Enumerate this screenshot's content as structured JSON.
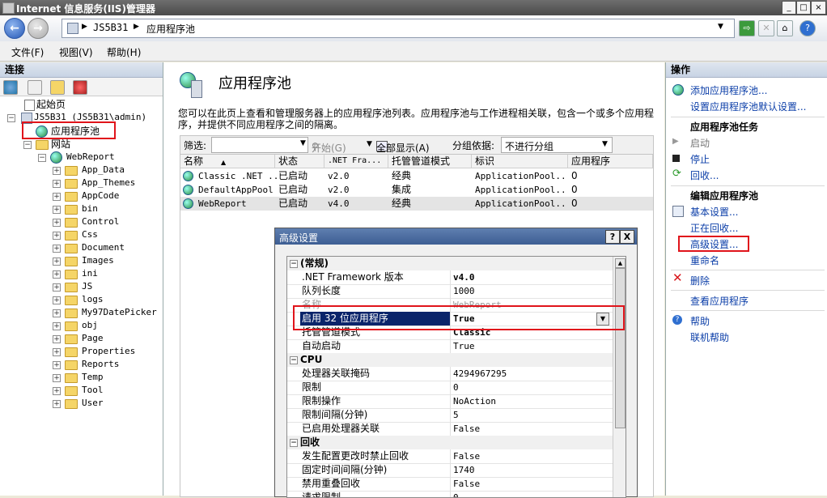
{
  "window": {
    "title": "Internet 信息服务(IIS)管理器"
  },
  "address": {
    "crumbs": [
      "JS5B31",
      "应用程序池"
    ]
  },
  "menu": [
    "文件(F)",
    "视图(V)",
    "帮助(H)"
  ],
  "connections": {
    "header": "连接",
    "tree": {
      "start_page": "起始页",
      "server": "JS5B31 (JS5B31\\admin)",
      "app_pools": "应用程序池",
      "sites": "网站",
      "site": "WebReport",
      "folders": [
        "App_Data",
        "App_Themes",
        "AppCode",
        "bin",
        "Control",
        "Css",
        "Document",
        "Images",
        "ini",
        "JS",
        "logs",
        "My97DatePicker",
        "obj",
        "Page",
        "Properties",
        "Reports",
        "Temp",
        "Tool",
        "User"
      ]
    }
  },
  "center": {
    "title": "应用程序池",
    "description": "您可以在此页上查看和管理服务器上的应用程序池列表。应用程序池与工作进程相关联，包含一个或多个应用程序，并提供不同应用程序之间的隔离。",
    "filter": {
      "label": "筛选:",
      "start": "开始(G)",
      "show_all": "全部显示(A)",
      "group_label": "分组依据:",
      "group_value": "不进行分组"
    },
    "columns": [
      "名称",
      "状态",
      ".NET Fra...",
      "托管管道模式",
      "标识",
      "应用程序"
    ],
    "rows": [
      {
        "name": "Classic .NET ...",
        "status": "已启动",
        "net": "v2.0",
        "mode": "经典",
        "identity": "ApplicationPool...",
        "apps": "0"
      },
      {
        "name": "DefaultAppPool",
        "status": "已启动",
        "net": "v2.0",
        "mode": "集成",
        "identity": "ApplicationPool...",
        "apps": "0"
      },
      {
        "name": "WebReport",
        "status": "已启动",
        "net": "v4.0",
        "mode": "经典",
        "identity": "ApplicationPool...",
        "apps": "0"
      }
    ]
  },
  "dialog": {
    "title": "高级设置",
    "help": "?",
    "close": "X",
    "categories": {
      "general": "(常规)",
      "cpu": "CPU",
      "recycle": "回收"
    },
    "general": [
      {
        "name": ".NET Framework 版本",
        "value": "v4.0"
      },
      {
        "name": "队列长度",
        "value": "1000"
      },
      {
        "name": "名称",
        "value": "WebReport"
      },
      {
        "name": "启用 32 位应用程序",
        "value": "True"
      },
      {
        "name": "托管管道模式",
        "value": "Classic"
      },
      {
        "name": "自动启动",
        "value": "True"
      }
    ],
    "cpu": [
      {
        "name": "处理器关联掩码",
        "value": "4294967295"
      },
      {
        "name": "限制",
        "value": "0"
      },
      {
        "name": "限制操作",
        "value": "NoAction"
      },
      {
        "name": "限制间隔(分钟)",
        "value": "5"
      },
      {
        "name": "已启用处理器关联",
        "value": "False"
      }
    ],
    "recycle": [
      {
        "name": "发生配置更改时禁止回收",
        "value": "False"
      },
      {
        "name": "固定时间间隔(分钟)",
        "value": "1740"
      },
      {
        "name": "禁用重叠回收",
        "value": "False"
      },
      {
        "name": "请求限制",
        "value": "0"
      }
    ]
  },
  "actions": {
    "header": "操作",
    "add_pool": "添加应用程序池...",
    "set_defaults": "设置应用程序池默认设置...",
    "tasks_header": "应用程序池任务",
    "start": "启动",
    "stop": "停止",
    "recycle": "回收...",
    "edit_header": "编辑应用程序池",
    "basic": "基本设置...",
    "recycling": "正在回收...",
    "advanced": "高级设置...",
    "rename": "重命名",
    "delete": "删除",
    "view_apps": "查看应用程序",
    "help": "帮助",
    "online_help": "联机帮助"
  },
  "colors": {
    "highlight_red": "#e0141b",
    "selection_blue": "#0a246a",
    "link_blue": "#0b3ea8"
  }
}
